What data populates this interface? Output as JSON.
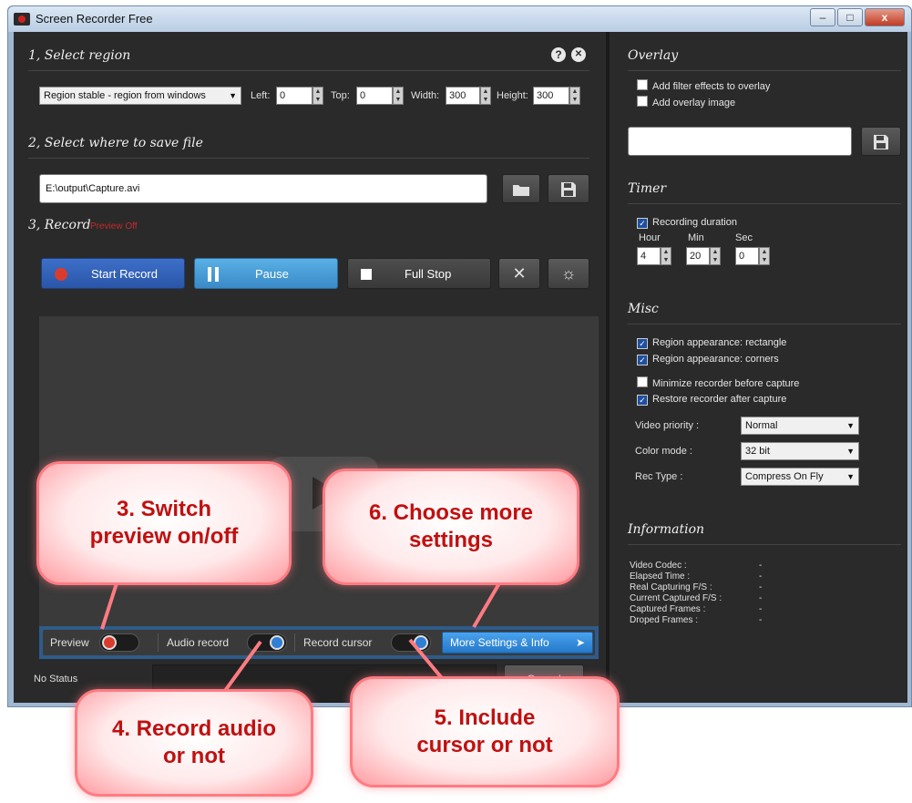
{
  "window": {
    "title": "Screen Recorder Free",
    "buttons": {
      "minimize": "–",
      "maximize": "□",
      "close": "x"
    }
  },
  "section1": {
    "title": "1, Select region",
    "help_icon": "?",
    "close_icon": "✕",
    "region_mode": "Region stable - region from windows",
    "left_label": "Left:",
    "left_value": "0",
    "top_label": "Top:",
    "top_value": "0",
    "width_label": "Width:",
    "width_value": "300",
    "height_label": "Height:",
    "height_value": "300"
  },
  "section2": {
    "title": "2, Select where to save file",
    "path": "E:\\output\\Capture.avi"
  },
  "section3": {
    "title": "3, Record",
    "hint": "Preview Off",
    "start_label": "Start Record",
    "pause_label": "Pause",
    "stop_label": "Full Stop"
  },
  "bottom_bar": {
    "preview_label": "Preview",
    "audio_label": "Audio record",
    "cursor_label": "Record cursor",
    "more_label": "More Settings & Info"
  },
  "status": {
    "text": "No Status",
    "button": "Cancel"
  },
  "overlay": {
    "title": "Overlay",
    "opt1": "Add filter effects to overlay",
    "opt2": "Add overlay image"
  },
  "timer": {
    "title": "Timer",
    "duration_label": "Recording duration",
    "hour_label": "Hour",
    "min_label": "Min",
    "sec_label": "Sec",
    "hour": "4",
    "min": "20",
    "sec": "0"
  },
  "misc": {
    "title": "Misc",
    "opt1": "Region appearance: rectangle",
    "opt2": "Region appearance: corners",
    "opt3": "Minimize recorder before capture",
    "opt4": "Restore recorder after capture",
    "priority_label": "Video priority :",
    "priority_value": "Normal",
    "color_label": "Color mode :",
    "color_value": "32 bit",
    "rectype_label": "Rec Type :",
    "rectype_value": "Compress On Fly"
  },
  "information": {
    "title": "Information",
    "rows": [
      {
        "label": "Video Codec :",
        "value": "-"
      },
      {
        "label": "Elapsed Time :",
        "value": "-"
      },
      {
        "label": "Real Capturing F/S :",
        "value": "-"
      },
      {
        "label": "Current Captured F/S :",
        "value": "-"
      },
      {
        "label": "Captured Frames :",
        "value": "-"
      },
      {
        "label": "Droped Frames :",
        "value": "-"
      }
    ]
  },
  "callouts": {
    "c3": "3. Switch\npreview on/off",
    "c4": "4. Record audio\nor not",
    "c5": "5. Include\ncursor or not",
    "c6": "6. Choose more\nsettings"
  },
  "colors": {
    "accent": "#2f7fd4",
    "callout_text": "#c01010",
    "callout_border": "#ff7b82"
  }
}
